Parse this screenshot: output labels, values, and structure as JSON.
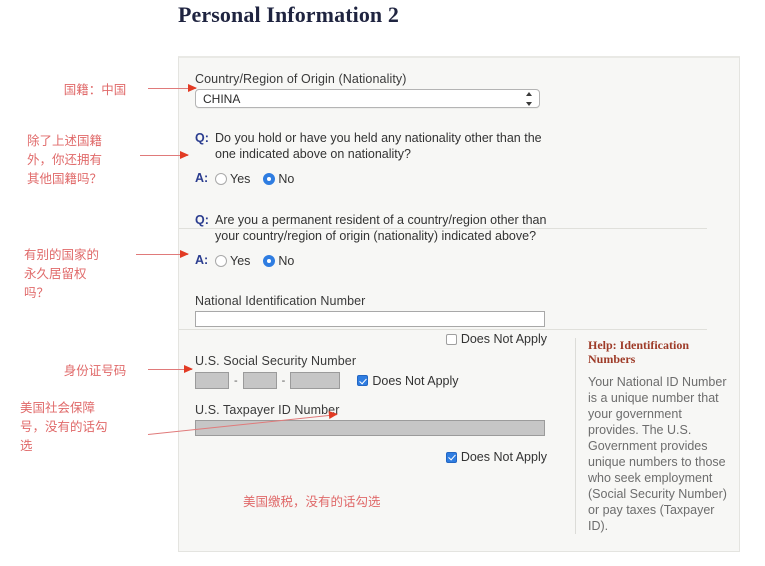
{
  "page": {
    "title": "Personal Information 2"
  },
  "nationality": {
    "label": "Country/Region of Origin (Nationality)",
    "selected": "CHINA",
    "options": [
      "CHINA"
    ]
  },
  "questions": [
    {
      "q_tag": "Q:",
      "a_tag": "A:",
      "text": "Do you hold or have you held any nationality other than the one indicated above on nationality?",
      "options": [
        "Yes",
        "No"
      ],
      "selected": "No"
    },
    {
      "q_tag": "Q:",
      "a_tag": "A:",
      "text": "Are you a permanent resident of a country/region other than your country/region of origin (nationality) indicated above?",
      "options": [
        "Yes",
        "No"
      ],
      "selected": "No"
    }
  ],
  "identification": {
    "national_id": {
      "label": "National Identification Number",
      "value": "",
      "does_not_apply_label": "Does Not Apply",
      "does_not_apply_checked": false,
      "disabled": false
    },
    "ssn": {
      "label": "U.S. Social Security Number",
      "part1": "",
      "part2": "",
      "part3": "",
      "separator": "-",
      "does_not_apply_label": "Does Not Apply",
      "does_not_apply_checked": true,
      "disabled": true
    },
    "taxpayer_id": {
      "label": "U.S. Taxpayer ID Number",
      "value": "",
      "does_not_apply_label": "Does Not Apply",
      "does_not_apply_checked": true,
      "disabled": true
    }
  },
  "help": {
    "title": "Help: Identification Numbers",
    "body": "Your National ID Number is a unique number that your government provides. The U.S. Government provides unique numbers to those who seek employment (Social Security Number) or pay taxes (Taxpayer ID)."
  },
  "annotations": [
    {
      "id": "nationality-note",
      "text": "国籍：中国"
    },
    {
      "id": "other-nationality-note",
      "text": "除了上述国籍\n外，你还拥有\n其他国籍吗？"
    },
    {
      "id": "permanent-resident-note",
      "text": "有别的国家的\n永久居留权\n吗？"
    },
    {
      "id": "national-id-note",
      "text": "身份证号码"
    },
    {
      "id": "ssn-note",
      "text": "美国社会保障\n号，没有的话勾\n选"
    },
    {
      "id": "taxpayer-note",
      "text": "美国缴税，没有的话勾选"
    }
  ],
  "colors": {
    "annotation": "#e06a6a",
    "arrow_head": "#e23b24",
    "accent_blue": "#2f7de1",
    "qa_tag": "#2b3d8f",
    "help_title": "#9e3b28",
    "panel_bg": "#f7f7f5"
  }
}
